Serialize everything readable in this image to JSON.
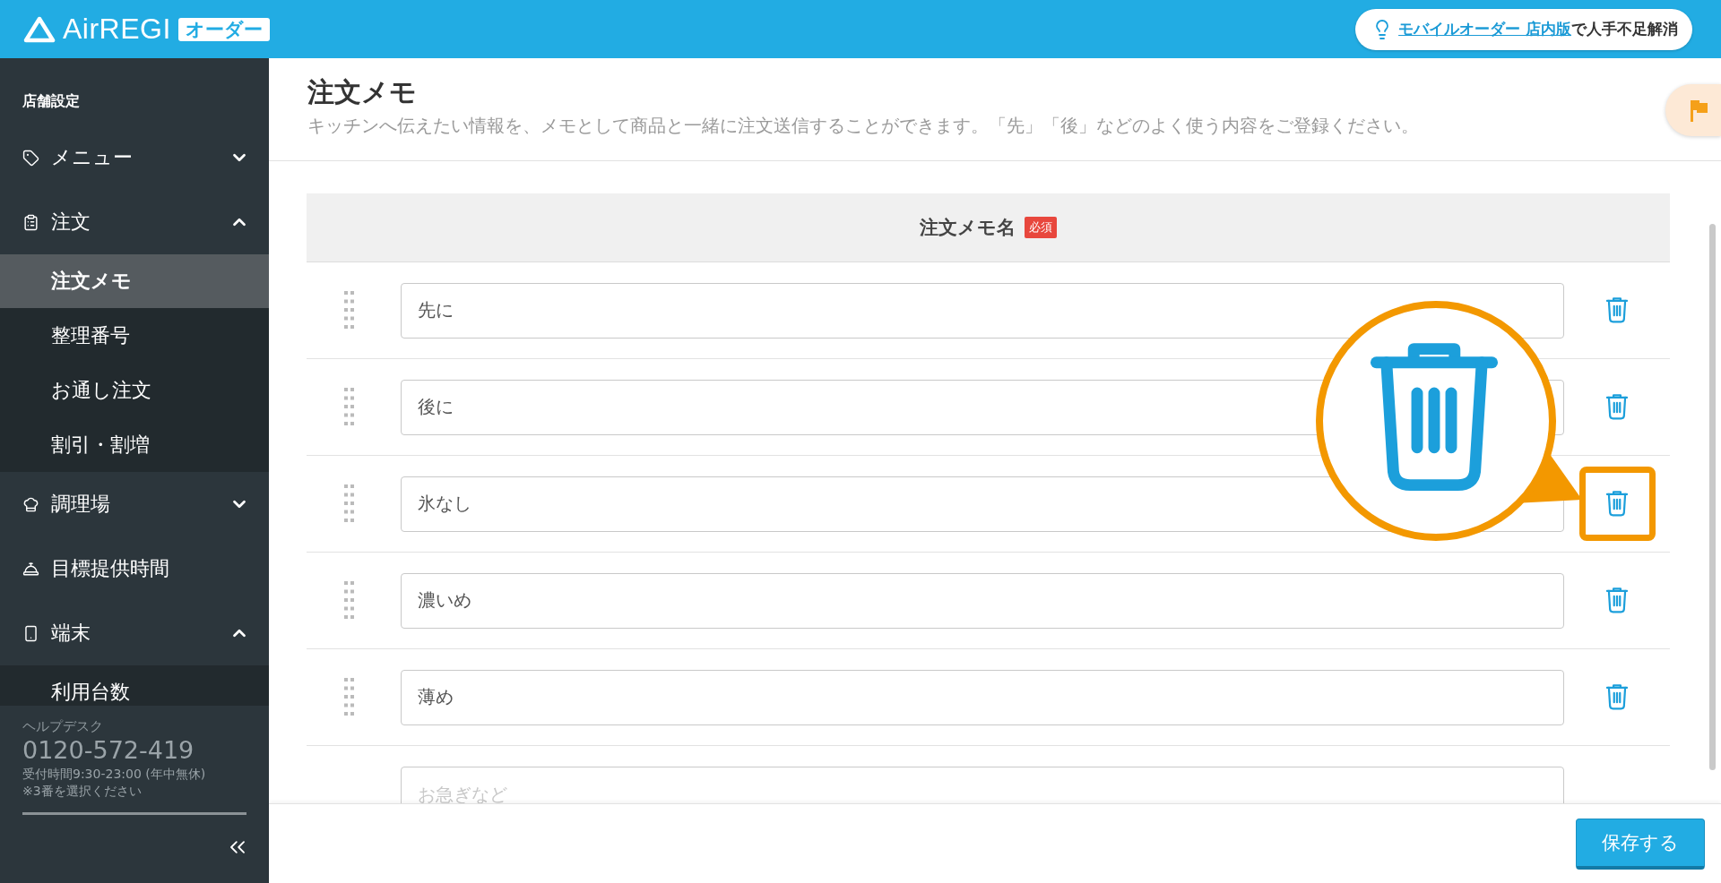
{
  "header": {
    "logo": {
      "name": "AirREGI",
      "badge": "オーダー"
    },
    "promo": {
      "link": "モバイルオーダー 店内版",
      "text": "で人手不足解消"
    }
  },
  "sidebar": {
    "section": "店舗設定",
    "items": [
      {
        "label": "メニュー",
        "kind": "group",
        "expanded": false
      },
      {
        "label": "注文",
        "kind": "group",
        "expanded": true,
        "children": [
          {
            "label": "注文メモ",
            "selected": true
          },
          {
            "label": "整理番号",
            "selected": false
          },
          {
            "label": "お通し注文",
            "selected": false
          },
          {
            "label": "割引・割増",
            "selected": false
          }
        ]
      },
      {
        "label": "調理場",
        "kind": "group",
        "expanded": false
      },
      {
        "label": "目標提供時間",
        "kind": "link"
      },
      {
        "label": "端末",
        "kind": "group",
        "expanded": true,
        "children": [
          {
            "label": "利用台数",
            "selected": false
          }
        ]
      }
    ],
    "helpdesk": {
      "label": "ヘルプデスク",
      "phone": "0120-572-419",
      "hours": "受付時間9:30-23:00 (年中無休)",
      "note": "※3番を選択ください"
    }
  },
  "page": {
    "title": "注文メモ",
    "description": "キッチンへ伝えたい情報を、メモとして商品と一緒に注文送信することができます。「先」「後」などのよく使う内容をご登録ください。"
  },
  "table": {
    "column": "注文メモ名",
    "required_badge": "必須",
    "rows": [
      {
        "value": "先に",
        "highlighted": false
      },
      {
        "value": "後に",
        "highlighted": false
      },
      {
        "value": "氷なし",
        "highlighted": true
      },
      {
        "value": "濃いめ",
        "highlighted": false
      },
      {
        "value": "薄め",
        "highlighted": false
      },
      {
        "placeholder": "お急ぎなど"
      }
    ]
  },
  "footer": {
    "save_button": "保存する"
  }
}
